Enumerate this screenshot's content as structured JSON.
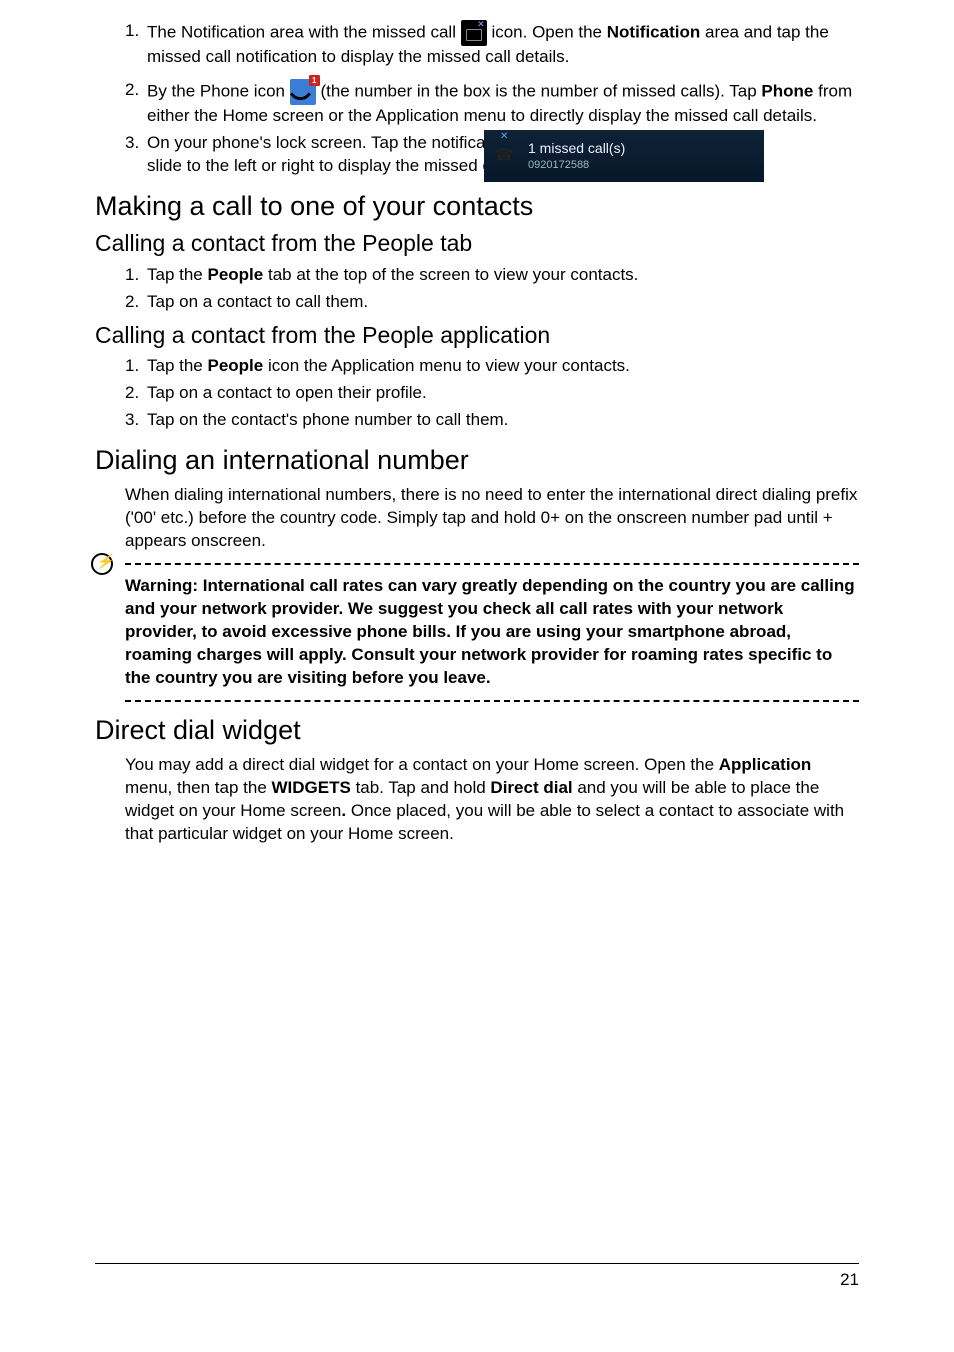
{
  "missed_calls_section": {
    "items": [
      {
        "num": "1.",
        "pre": "The Notification area with the missed call ",
        "post_pre": " icon. Open the ",
        "bold1": "Notification",
        "post_bold": " area and tap the missed call notification to display the missed call details."
      },
      {
        "num": "2.",
        "pre": "By the Phone icon ",
        "post_pre": " (the number in the box is the number of missed calls). Tap ",
        "bold1": "Phone",
        "post_bold": " from either the Home screen or the Application menu to directly display the missed call details."
      },
      {
        "num": "3.",
        "text": "On your phone's lock screen. Tap the notification and slide to the left or right to display the missed call details."
      }
    ]
  },
  "notif_widget": {
    "line1": "1 missed call(s)",
    "line2": "0920172588"
  },
  "section_making_call": {
    "heading": "Making a call to one of your contacts",
    "sub1": {
      "heading": "Calling a contact from the People tab",
      "items": [
        {
          "num": "1.",
          "pre": "Tap the ",
          "bold": "People",
          "post": " tab at the top of the screen to view your contacts."
        },
        {
          "num": "2.",
          "text": "Tap on a contact to call them."
        }
      ]
    },
    "sub2": {
      "heading": "Calling a contact from the People application",
      "items": [
        {
          "num": "1.",
          "pre": "Tap the ",
          "bold": "People",
          "post": " icon the Application menu to view your contacts."
        },
        {
          "num": "2.",
          "text": "Tap on a contact to open their profile."
        },
        {
          "num": "3.",
          "text": "Tap on the contact's phone number to call them."
        }
      ]
    }
  },
  "section_international": {
    "heading": "Dialing an international number",
    "para": "When dialing international numbers, there is no need to enter the international direct dialing prefix ('00' etc.) before the country code. Simply tap and hold 0+ on the onscreen number pad until + appears onscreen.",
    "warning": "Warning: International call rates can vary greatly depending on the country you are calling and your network provider. We suggest you check all call rates with your network provider, to avoid excessive phone bills. If you are using your smartphone abroad, roaming charges will apply. Consult your network provider for roaming rates specific to the country you are visiting before you leave."
  },
  "section_direct_dial": {
    "heading": "Direct dial widget",
    "p1": "You may add a direct dial widget for a contact on your Home screen. Open the ",
    "b1": "Application",
    "p2": " menu, then tap the ",
    "b2": "WIDGETS",
    "p3": " tab. Tap and hold ",
    "b3": "Direct dial",
    "p4": " and you will be able to place the widget on your Home screen",
    "b4": ".",
    "p5": " Once placed, you will be able to select a contact to associate with that particular widget on your Home screen."
  },
  "page_number": "21"
}
